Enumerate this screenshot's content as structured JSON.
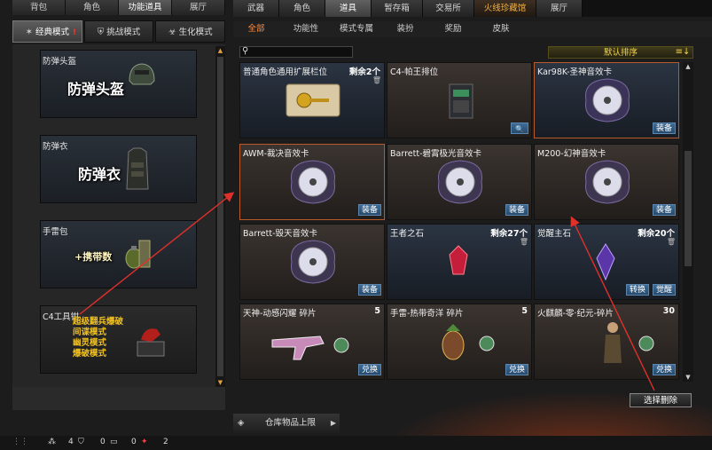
{
  "left_tabs": [
    "背包",
    "角色",
    "功能道具",
    "展厅"
  ],
  "modes": [
    {
      "icon": "swords-icon",
      "label": "经典模式"
    },
    {
      "icon": "shield-icon",
      "label": "挑战模式"
    },
    {
      "icon": "biohazard-icon",
      "label": "生化模式"
    }
  ],
  "slots": [
    {
      "caption": "防弹头盔",
      "big": "防弹头盔"
    },
    {
      "caption": "防弹衣",
      "big": "防弹衣"
    },
    {
      "caption": "手雷包",
      "big": "+携带数"
    },
    {
      "caption": "C4工具钳",
      "lines": [
        "超级翻兵爆破",
        "间谍模式",
        "幽灵模式",
        "爆破模式"
      ]
    }
  ],
  "right_tabs": [
    "武器",
    "角色",
    "道具",
    "暂存箱",
    "交易所",
    "火线珍藏馆",
    "展厅"
  ],
  "sub_tabs": [
    "全部",
    "功能性",
    "模式专属",
    "装扮",
    "奖励",
    "皮肤"
  ],
  "search_placeholder": "",
  "sort_label": "默认排序",
  "items": [
    {
      "title": "普通角色通用扩展栏位",
      "count": "剩余2个",
      "buttons": [],
      "theme": "blue",
      "art": "ticket"
    },
    {
      "title": "C4-帕王排位",
      "count": "",
      "buttons": [
        "magnifier"
      ],
      "theme": "brown",
      "art": "c4"
    },
    {
      "title": "Kar98K-圣神音效卡",
      "count": "",
      "buttons": [
        "装备"
      ],
      "theme": "blue",
      "art": "disc"
    },
    {
      "title": "AWM-裁决音效卡",
      "count": "",
      "buttons": [
        "装备"
      ],
      "theme": "brown",
      "art": "disc"
    },
    {
      "title": "Barrett-碧霄极光音效卡",
      "count": "",
      "buttons": [
        "装备"
      ],
      "theme": "brown",
      "art": "disc"
    },
    {
      "title": "M200-幻神音效卡",
      "count": "",
      "buttons": [
        "装备"
      ],
      "theme": "brown",
      "art": "disc"
    },
    {
      "title": "Barrett-毁天音效卡",
      "count": "",
      "buttons": [
        "装备"
      ],
      "theme": "brown",
      "art": "disc"
    },
    {
      "title": "王者之石",
      "count": "剩余27个",
      "buttons": [],
      "theme": "blue",
      "art": "redgem"
    },
    {
      "title": "觉醒主石",
      "count": "剩余20个",
      "buttons": [
        "转换",
        "觉醒"
      ],
      "theme": "blue",
      "art": "purplegem"
    },
    {
      "title": "天神-动感闪耀 碎片",
      "count": "5",
      "buttons": [
        "兑换"
      ],
      "theme": "brown",
      "art": "gun"
    },
    {
      "title": "手雷-热带奇洋 碎片",
      "count": "5",
      "buttons": [
        "兑换"
      ],
      "theme": "brown",
      "art": "grenade"
    },
    {
      "title": "火麒麟-零·纪元-碎片",
      "count": "30",
      "buttons": [
        "兑换"
      ],
      "theme": "brown",
      "art": "soldier"
    }
  ],
  "delete_button": "选择删除",
  "storage_limit": "仓库物品上限",
  "status": [
    {
      "icon": "bullet-icon",
      "value": "4"
    },
    {
      "icon": "shield-icon",
      "value": "0"
    },
    {
      "icon": "ticket-icon",
      "value": "0"
    },
    {
      "icon": "gift-icon",
      "value": "2"
    }
  ],
  "colors": {
    "accent": "#ff8c3a",
    "sort_text": "#f6d34a",
    "button_blue": "#3e6c98",
    "arrow_red": "#e0302a"
  }
}
